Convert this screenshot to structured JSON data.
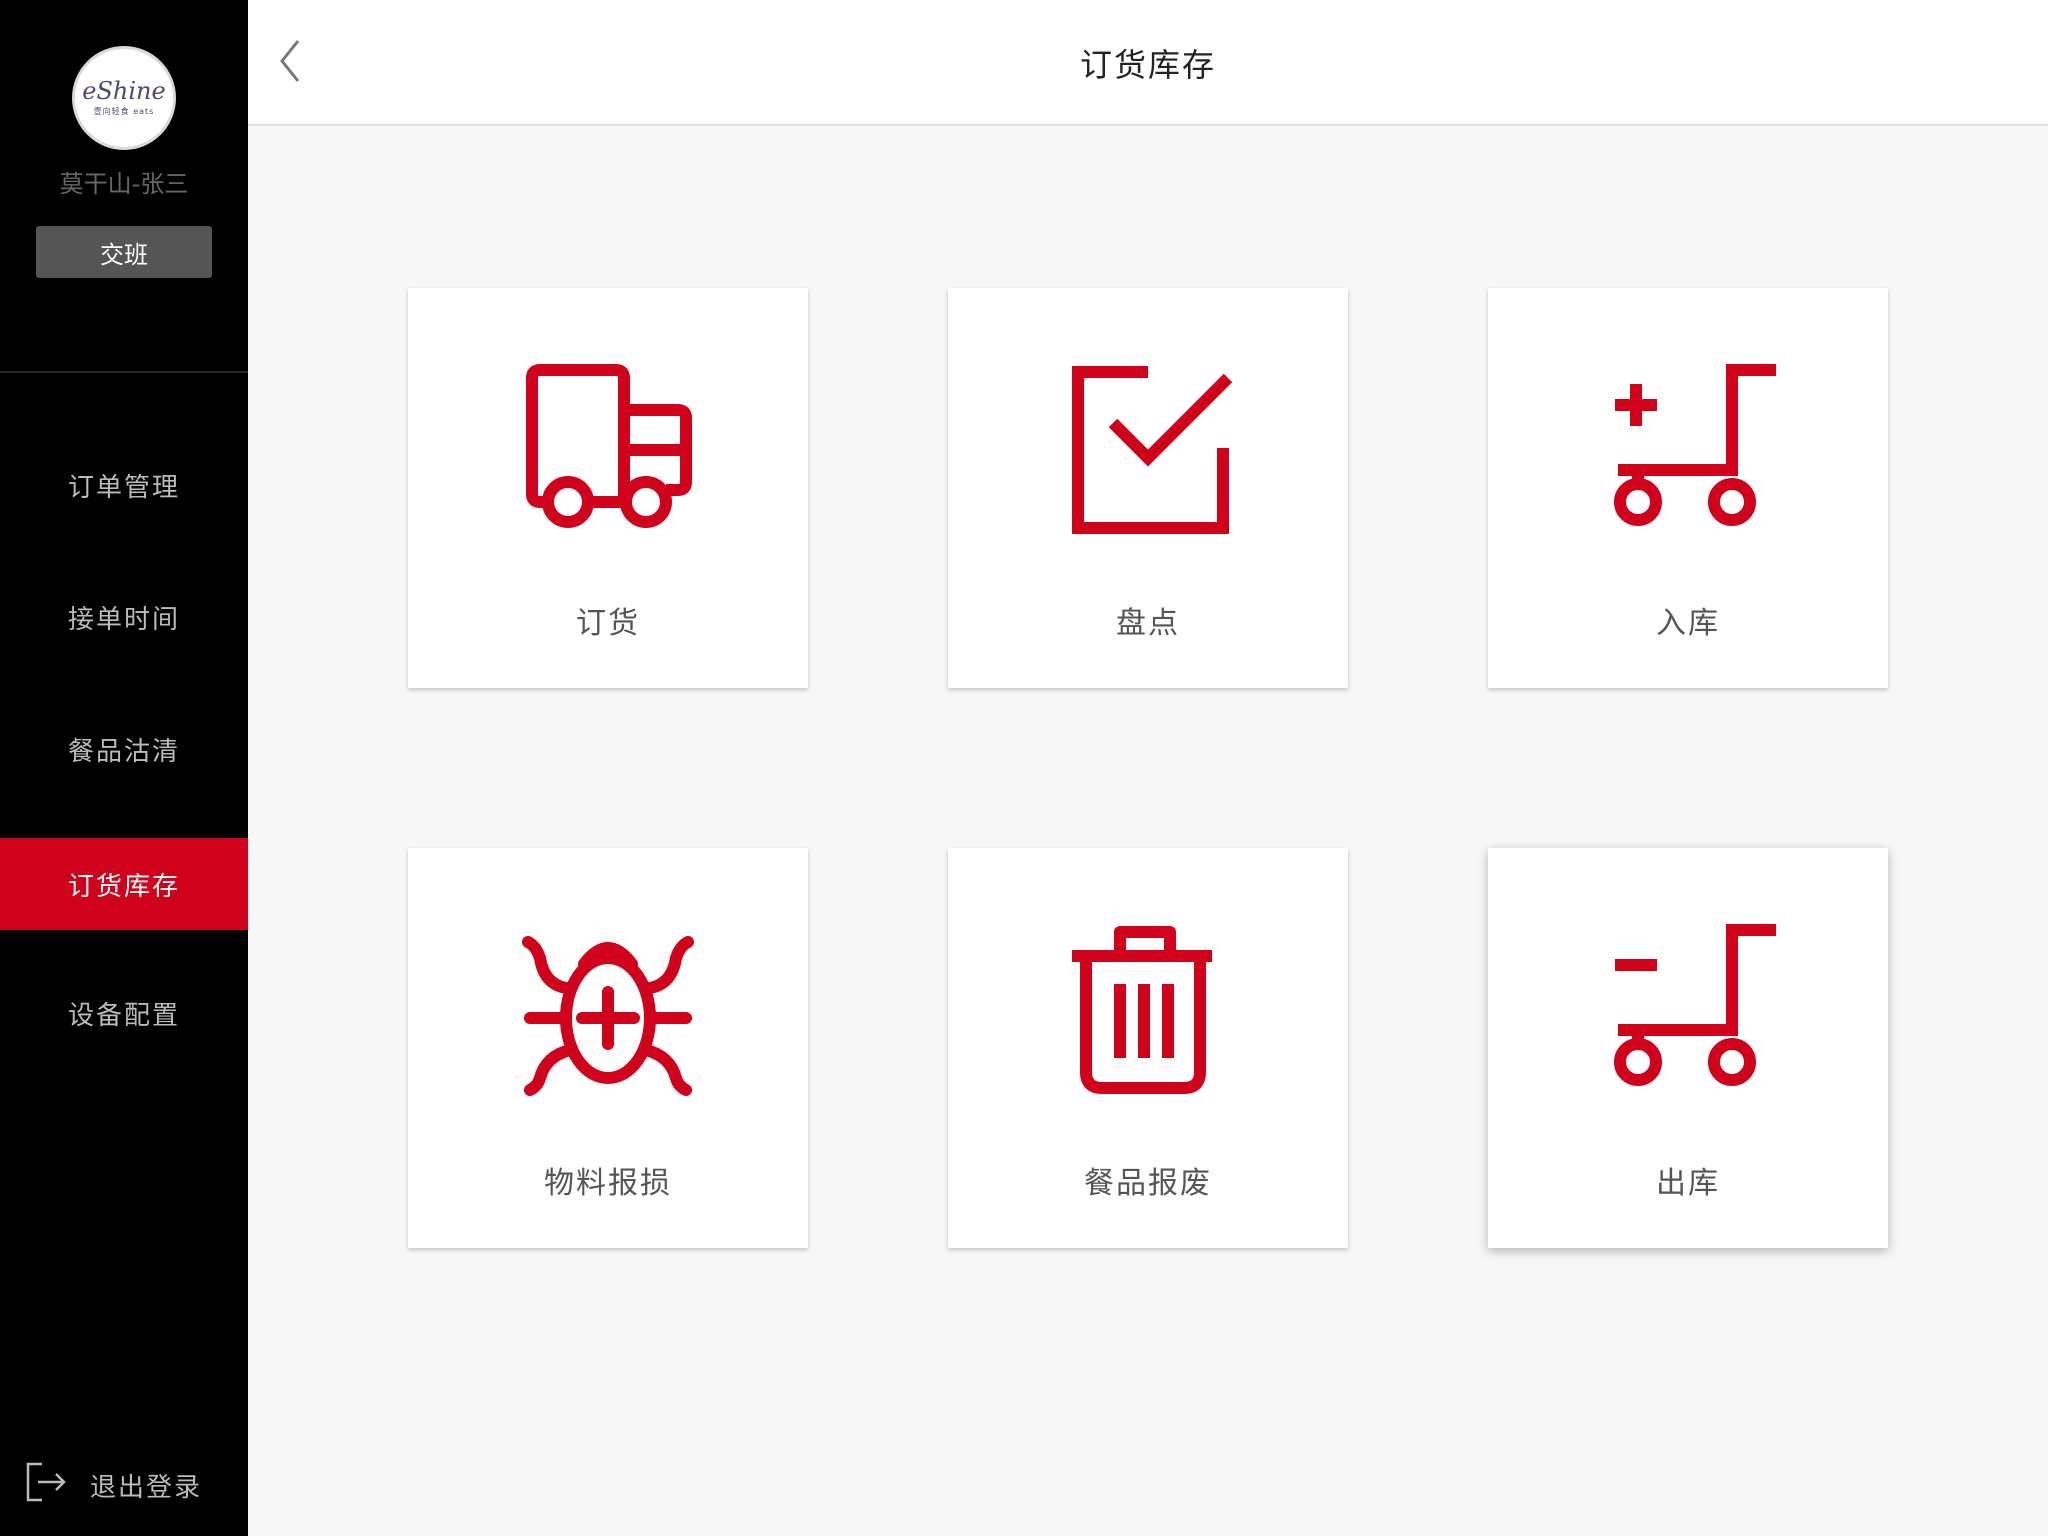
{
  "sidebar": {
    "avatar": {
      "brand": "eShine",
      "sub": "壹向轻食 eats"
    },
    "user_name": "莫干山-张三",
    "shift_label": "交班",
    "nav_items": [
      {
        "label": "订单管理",
        "active": false
      },
      {
        "label": "接单时间",
        "active": false
      },
      {
        "label": "餐品沽清",
        "active": false
      },
      {
        "label": "订货库存",
        "active": true
      },
      {
        "label": "设备配置",
        "active": false
      }
    ],
    "logout_label": "退出登录"
  },
  "header": {
    "title": "订货库存",
    "back_icon": "chevron-left-icon"
  },
  "tiles": [
    {
      "label": "订货",
      "icon": "truck-icon"
    },
    {
      "label": "盘点",
      "icon": "checkbox-icon"
    },
    {
      "label": "入库",
      "icon": "cart-plus-icon"
    },
    {
      "label": "物料报损",
      "icon": "bug-plus-icon"
    },
    {
      "label": "餐品报废",
      "icon": "trash-icon"
    },
    {
      "label": "出库",
      "icon": "cart-minus-icon"
    }
  ],
  "colors": {
    "accent": "#d0021b",
    "sidebar_bg": "#000000",
    "content_bg": "#f7f7f7"
  }
}
